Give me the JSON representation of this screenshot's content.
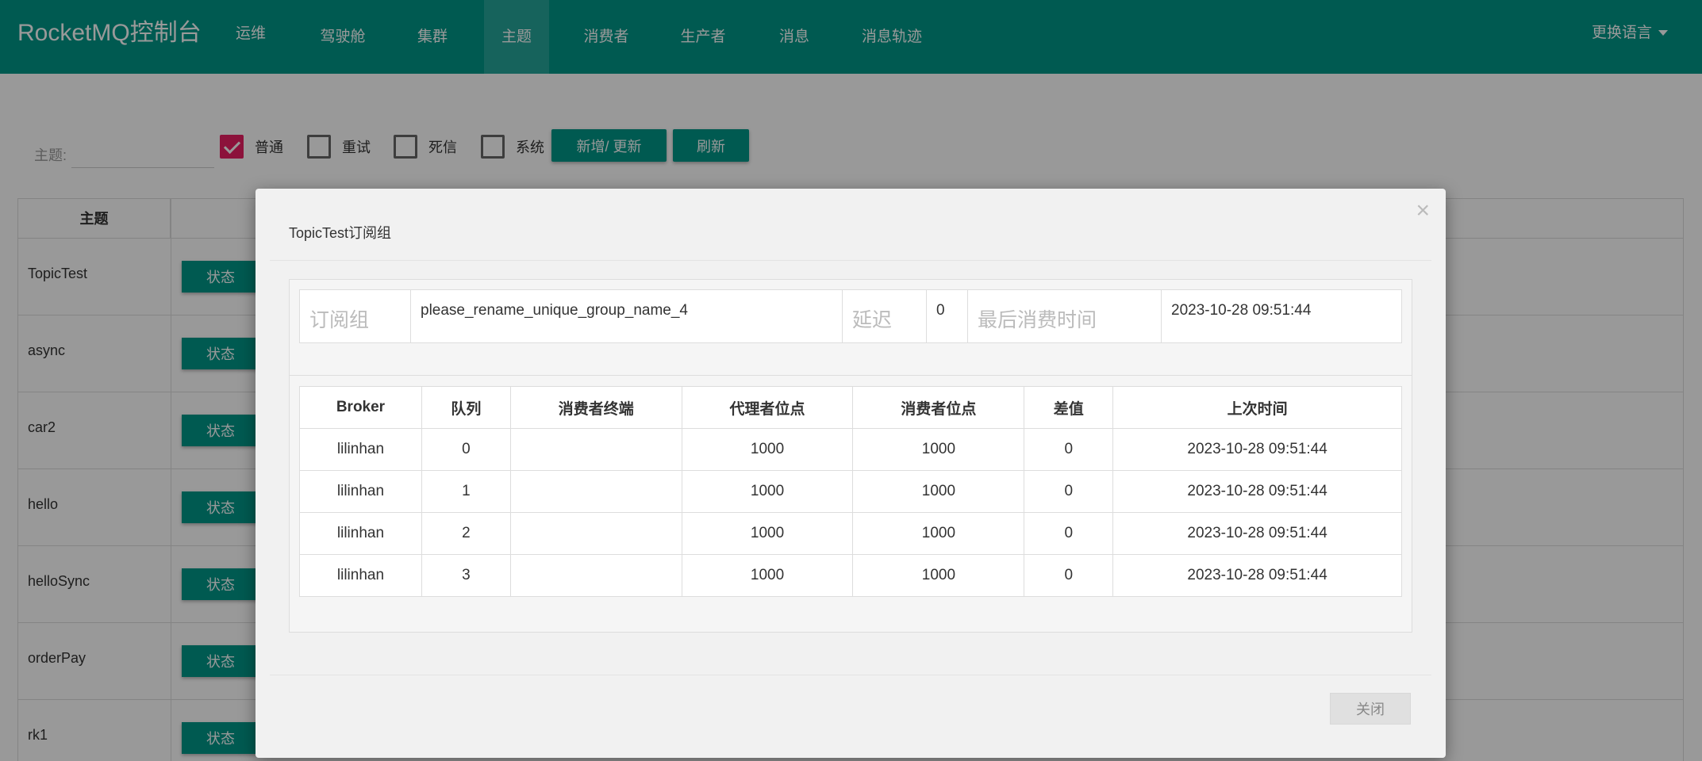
{
  "navbar": {
    "brand": "RocketMQ控制台",
    "items": [
      "运维",
      "驾驶舱",
      "集群",
      "主题",
      "消费者",
      "生产者",
      "消息",
      "消息轨迹"
    ],
    "active_index": 3,
    "language": "更换语言"
  },
  "filter": {
    "topic_label": "主题:",
    "topic_value": "",
    "checkboxes": [
      {
        "label": "普通",
        "checked": true
      },
      {
        "label": "重试",
        "checked": false
      },
      {
        "label": "死信",
        "checked": false
      },
      {
        "label": "系统",
        "checked": false
      }
    ],
    "add_update_button": "新增/ 更新",
    "refresh_button": "刷新"
  },
  "topic_table": {
    "header": "主题",
    "rows": [
      {
        "name": "TopicTest",
        "action": "状态"
      },
      {
        "name": "async",
        "action": "状态"
      },
      {
        "name": "car2",
        "action": "状态"
      },
      {
        "name": "hello",
        "action": "状态"
      },
      {
        "name": "helloSync",
        "action": "状态"
      },
      {
        "name": "orderPay",
        "action": "状态"
      },
      {
        "name": "rk1",
        "action": "状态"
      }
    ]
  },
  "modal": {
    "title": "TopicTest订阅组",
    "close_symbol": "×",
    "info": {
      "group_label": "订阅组",
      "group_value": "please_rename_unique_group_name_4",
      "delay_label": "延迟",
      "delay_value": "0",
      "last_consume_label": "最后消费时间",
      "last_consume_value": "2023-10-28 09:51:44"
    },
    "table": {
      "columns": [
        "Broker",
        "队列",
        "消费者终端",
        "代理者位点",
        "消费者位点",
        "差值",
        "上次时间"
      ],
      "rows": [
        [
          "lilinhan",
          "0",
          "",
          "1000",
          "1000",
          "0",
          "2023-10-28 09:51:44"
        ],
        [
          "lilinhan",
          "1",
          "",
          "1000",
          "1000",
          "0",
          "2023-10-28 09:51:44"
        ],
        [
          "lilinhan",
          "2",
          "",
          "1000",
          "1000",
          "0",
          "2023-10-28 09:51:44"
        ],
        [
          "lilinhan",
          "3",
          "",
          "1000",
          "1000",
          "0",
          "2023-10-28 09:51:44"
        ]
      ]
    },
    "close_button": "关闭"
  },
  "colors": {
    "primary": "#009688",
    "checkbox_checked": "#e91e63"
  }
}
